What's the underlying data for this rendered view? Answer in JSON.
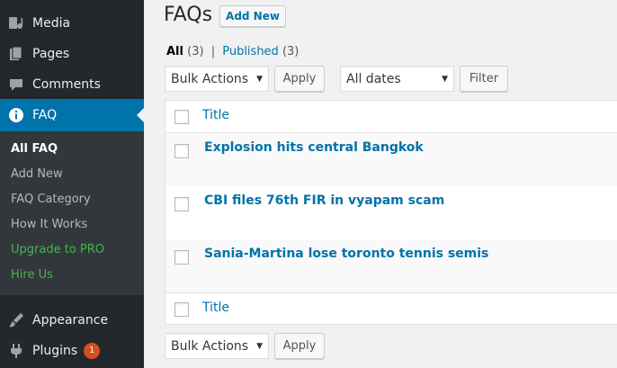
{
  "sidebar": {
    "items": [
      {
        "label": "Media",
        "icon": "media-icon"
      },
      {
        "label": "Pages",
        "icon": "pages-icon"
      },
      {
        "label": "Comments",
        "icon": "comments-icon"
      },
      {
        "label": "FAQ",
        "icon": "info-icon"
      },
      {
        "label": "Appearance",
        "icon": "appearance-icon"
      },
      {
        "label": "Plugins",
        "icon": "plugins-icon",
        "badge": "1"
      }
    ],
    "submenu": [
      {
        "label": "All FAQ"
      },
      {
        "label": "Add New"
      },
      {
        "label": "FAQ Category"
      },
      {
        "label": "How It Works"
      },
      {
        "label": "Upgrade to PRO"
      },
      {
        "label": "Hire Us"
      }
    ]
  },
  "header": {
    "title": "FAQs",
    "add_new_label": "Add New"
  },
  "filters": {
    "all_label": "All",
    "all_count": "(3)",
    "separator": "|",
    "published_label": "Published",
    "published_count": "(3)"
  },
  "actions": {
    "bulk_label": "Bulk Actions",
    "apply_label": "Apply",
    "dates_label": "All dates",
    "filter_label": "Filter"
  },
  "table": {
    "column_title": "Title",
    "rows": [
      {
        "title": "Explosion hits central Bangkok"
      },
      {
        "title": "CBI files 76th FIR in vyapam scam"
      },
      {
        "title": "Sania-Martina lose toronto tennis semis"
      }
    ]
  },
  "colors": {
    "sidebar_bg": "#23282d",
    "submenu_bg": "#32373c",
    "active_bg": "#0073aa",
    "link": "#0073aa",
    "green": "#46b450",
    "badge": "#d54e21"
  }
}
